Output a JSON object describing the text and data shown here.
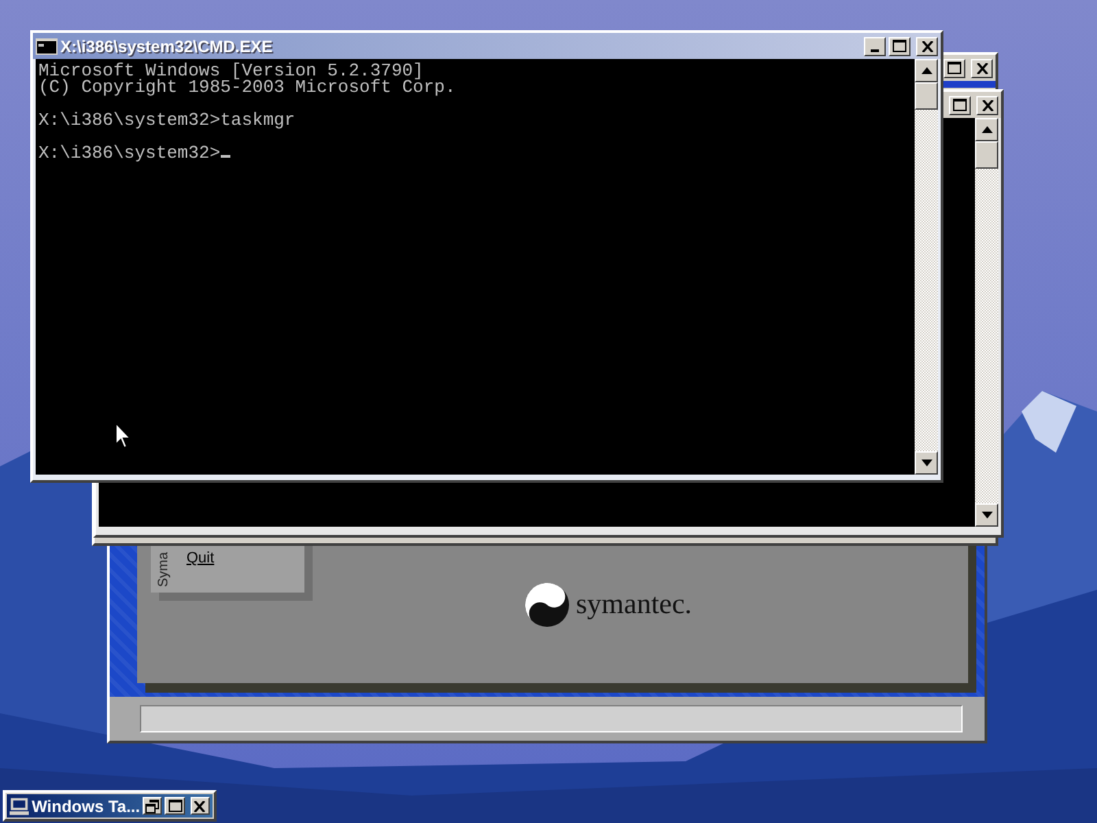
{
  "console_window": {
    "title": "X:\\i386\\system32\\CMD.EXE",
    "output": [
      [
        "Microsoft Windows [Version 5.2.3790]",
        "(C) Copyright 1985-2003 Microsoft Corp."
      ],
      [
        "X:\\i386\\system32>taskmgr"
      ],
      [
        "X:\\i386\\system32>"
      ]
    ]
  },
  "setup_window": {
    "menu_label": "Syma",
    "menu_items": [
      "Quit"
    ],
    "brand": "symantec."
  },
  "minimized_window": {
    "title": "Windows Ta..."
  }
}
